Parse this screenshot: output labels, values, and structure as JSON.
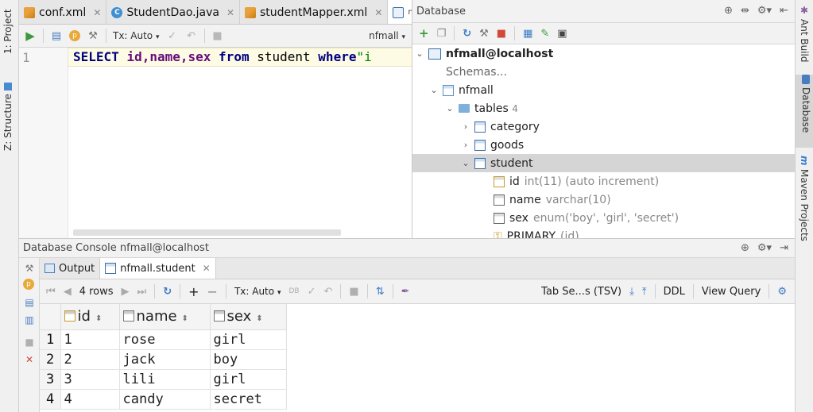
{
  "left_strip": {
    "project_label": "1: Project",
    "structure_label": "Z: Structure"
  },
  "right_strip": {
    "ant_label": "Ant Build",
    "database_label": "Database",
    "maven_label": "Maven Projects"
  },
  "editor_tabs": [
    {
      "label": "conf.xml",
      "icon": "xml-file-icon"
    },
    {
      "label": "StudentDao.java",
      "icon": "java-class-icon"
    },
    {
      "label": "studentMapper.xml",
      "icon": "xml-file-icon"
    },
    {
      "label": "nf",
      "icon": "sql-console-icon"
    }
  ],
  "editor_toolbar": {
    "tx_mode": "Tx: Auto",
    "schema": "nfmall"
  },
  "editor": {
    "line_number": "1",
    "code": {
      "kw_select": "SELECT",
      "cols": "id,name,sex",
      "kw_from": "from",
      "table": "student",
      "kw_where": "where",
      "tail": "\"i"
    }
  },
  "db_panel": {
    "title": "Database",
    "tree": {
      "connection": "nfmall@localhost",
      "schemas": "Schemas...",
      "schema_name": "nfmall",
      "tables_label": "tables",
      "tables_count": "4",
      "tables": [
        "category",
        "goods",
        "student"
      ],
      "columns": [
        {
          "name": "id",
          "type": "int(11) (auto increment)"
        },
        {
          "name": "name",
          "type": "varchar(10)"
        },
        {
          "name": "sex",
          "type": "enum('boy', 'girl', 'secret')"
        }
      ],
      "key": {
        "name": "PRIMARY",
        "type": "(id)"
      }
    }
  },
  "console": {
    "title": "Database Console nfmall@localhost",
    "tabs": {
      "output": "Output",
      "result": "nfmall.student"
    },
    "toolbar": {
      "rows": "4 rows",
      "tx_mode": "Tx: Auto",
      "export_format": "Tab Se...s (TSV)",
      "ddl": "DDL",
      "view_query": "View Query"
    },
    "columns": [
      "id",
      "name",
      "sex"
    ],
    "rows": [
      {
        "num": "1",
        "id": "1",
        "name": "rose",
        "sex": "girl"
      },
      {
        "num": "2",
        "id": "2",
        "name": "jack",
        "sex": "boy"
      },
      {
        "num": "3",
        "id": "3",
        "name": "lili",
        "sex": "girl"
      },
      {
        "num": "4",
        "id": "4",
        "name": "candy",
        "sex": "secret"
      }
    ]
  },
  "colors": {
    "keyword": "#000080",
    "identifier": "#660e7a",
    "selection": "#d5d5d5",
    "current_line": "#fdfbe4"
  }
}
